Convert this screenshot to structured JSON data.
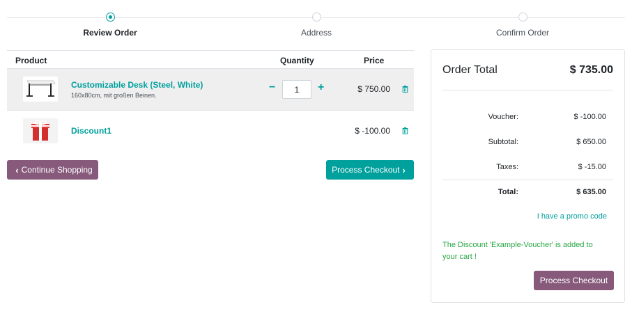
{
  "steps": [
    {
      "label": "Review Order",
      "active": true
    },
    {
      "label": "Address",
      "active": false
    },
    {
      "label": "Confirm Order",
      "active": false
    }
  ],
  "cart": {
    "columns": {
      "product": "Product",
      "quantity": "Quantity",
      "price": "Price"
    },
    "lines": [
      {
        "name": "Customizable Desk (Steel, White)",
        "description": "160x80cm, mit großen Beinen.",
        "quantity": "1",
        "price": "$ 750.00",
        "image_icon": "desk-icon"
      },
      {
        "name": "Discount1",
        "description": "",
        "price": "$ -100.00",
        "image_icon": "gift-icon"
      }
    ],
    "continue_label": "Continue Shopping",
    "checkout_label": "Process Checkout"
  },
  "summary": {
    "title": "Order Total",
    "total": "$ 735.00",
    "rows": [
      {
        "label": "Voucher:",
        "value": "$ -100.00"
      },
      {
        "label": "Subtotal:",
        "value": "$ 650.00"
      },
      {
        "label": "Taxes:",
        "value": "$ -15.00"
      },
      {
        "label": "Total:",
        "value": "$ 635.00"
      }
    ],
    "promo_link": "I have a promo code",
    "discount_message": "The Discount 'Example-Voucher' is added to your cart !",
    "checkout_label": "Process Checkout"
  },
  "colors": {
    "accent": "#00A09D",
    "secondary": "#875A7B",
    "success": "#28a745"
  }
}
